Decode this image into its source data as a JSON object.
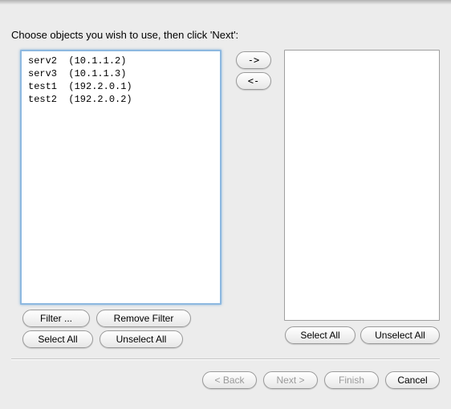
{
  "instruction": "Choose objects you wish to use, then click 'Next':",
  "left_items": [
    "serv2  (10.1.1.2)",
    "serv3  (10.1.1.3)",
    "test1  (192.2.0.1)",
    "test2  (192.2.0.2)"
  ],
  "right_items": [],
  "buttons": {
    "move_right": "->",
    "move_left": "<-",
    "filter": "Filter ...",
    "remove_filter": "Remove Filter",
    "select_all": "Select All",
    "unselect_all": "Unselect All",
    "back": "< Back",
    "next": "Next >",
    "finish": "Finish",
    "cancel": "Cancel"
  }
}
